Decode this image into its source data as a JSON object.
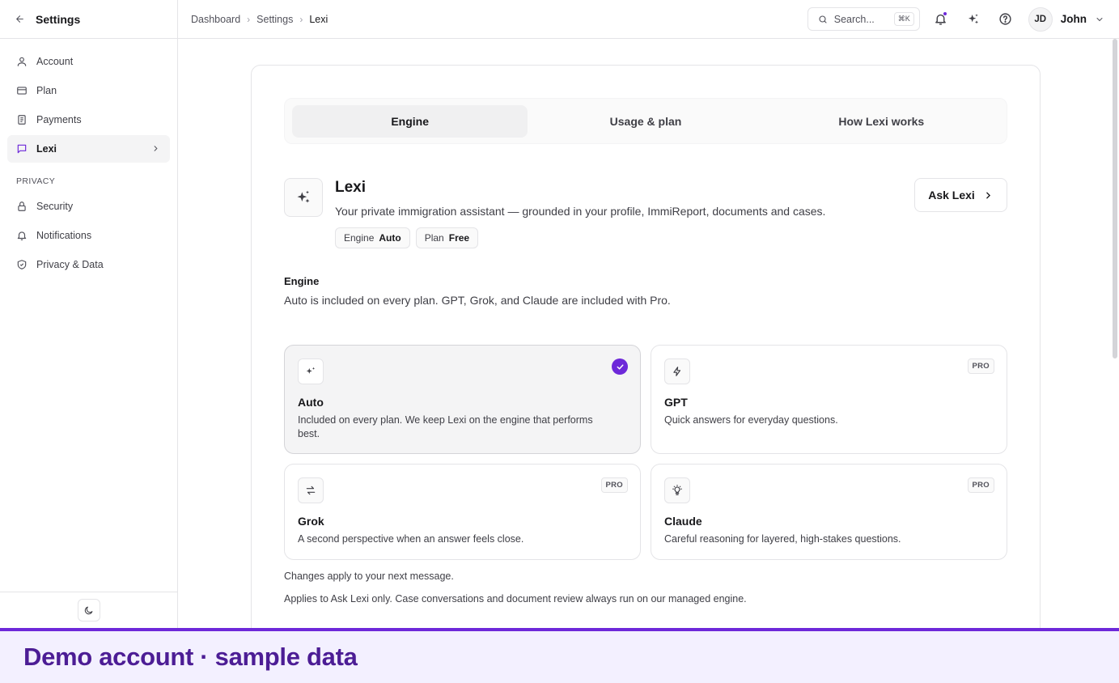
{
  "sidebar": {
    "title": "Settings",
    "items": [
      {
        "label": "Account",
        "icon": "user-icon"
      },
      {
        "label": "Plan",
        "icon": "card-icon"
      },
      {
        "label": "Payments",
        "icon": "receipt-icon"
      },
      {
        "label": "Lexi",
        "icon": "chat-icon",
        "active": true
      }
    ],
    "section_label": "PRIVACY",
    "privacy_items": [
      {
        "label": "Security",
        "icon": "lock-icon"
      },
      {
        "label": "Notifications",
        "icon": "bell-icon"
      },
      {
        "label": "Privacy & Data",
        "icon": "shield-icon"
      }
    ]
  },
  "breadcrumb": [
    "Dashboard",
    "Settings",
    "Lexi"
  ],
  "search": {
    "placeholder": "Search...",
    "shortcut": "⌘K"
  },
  "user": {
    "initials": "JD",
    "name": "John"
  },
  "tabs": [
    {
      "label": "Engine",
      "active": true
    },
    {
      "label": "Usage & plan"
    },
    {
      "label": "How Lexi works"
    }
  ],
  "hero": {
    "title": "Lexi",
    "subtitle": "Your private immigration assistant — grounded in your profile, ImmiReport, documents and cases.",
    "chips": [
      {
        "key": "Engine",
        "value": "Auto"
      },
      {
        "key": "Plan",
        "value": "Free"
      }
    ],
    "ask_label": "Ask Lexi"
  },
  "engine": {
    "heading": "Engine",
    "description": "Auto is included on every plan. GPT, Grok, and Claude are included with Pro.",
    "options": [
      {
        "title": "Auto",
        "desc": "Included on every plan. We keep Lexi on the engine that performs best.",
        "selected": true,
        "icon": "sparkles-icon"
      },
      {
        "title": "GPT",
        "desc": "Quick answers for everyday questions.",
        "badge": "PRO",
        "icon": "bolt-icon"
      },
      {
        "title": "Grok",
        "desc": "A second perspective when an answer feels close.",
        "badge": "PRO",
        "icon": "swap-icon"
      },
      {
        "title": "Claude",
        "desc": "Careful reasoning for layered, high-stakes questions.",
        "badge": "PRO",
        "icon": "lightbulb-icon"
      }
    ],
    "note1": "Changes apply to your next message.",
    "note2": "Applies to Ask Lexi only. Case conversations and document review always run on our managed engine."
  },
  "banner": "Demo account · sample data",
  "colors": {
    "accent": "#6d28d9",
    "banner_bg": "#f3f0ff",
    "banner_text": "#4c1d95"
  }
}
